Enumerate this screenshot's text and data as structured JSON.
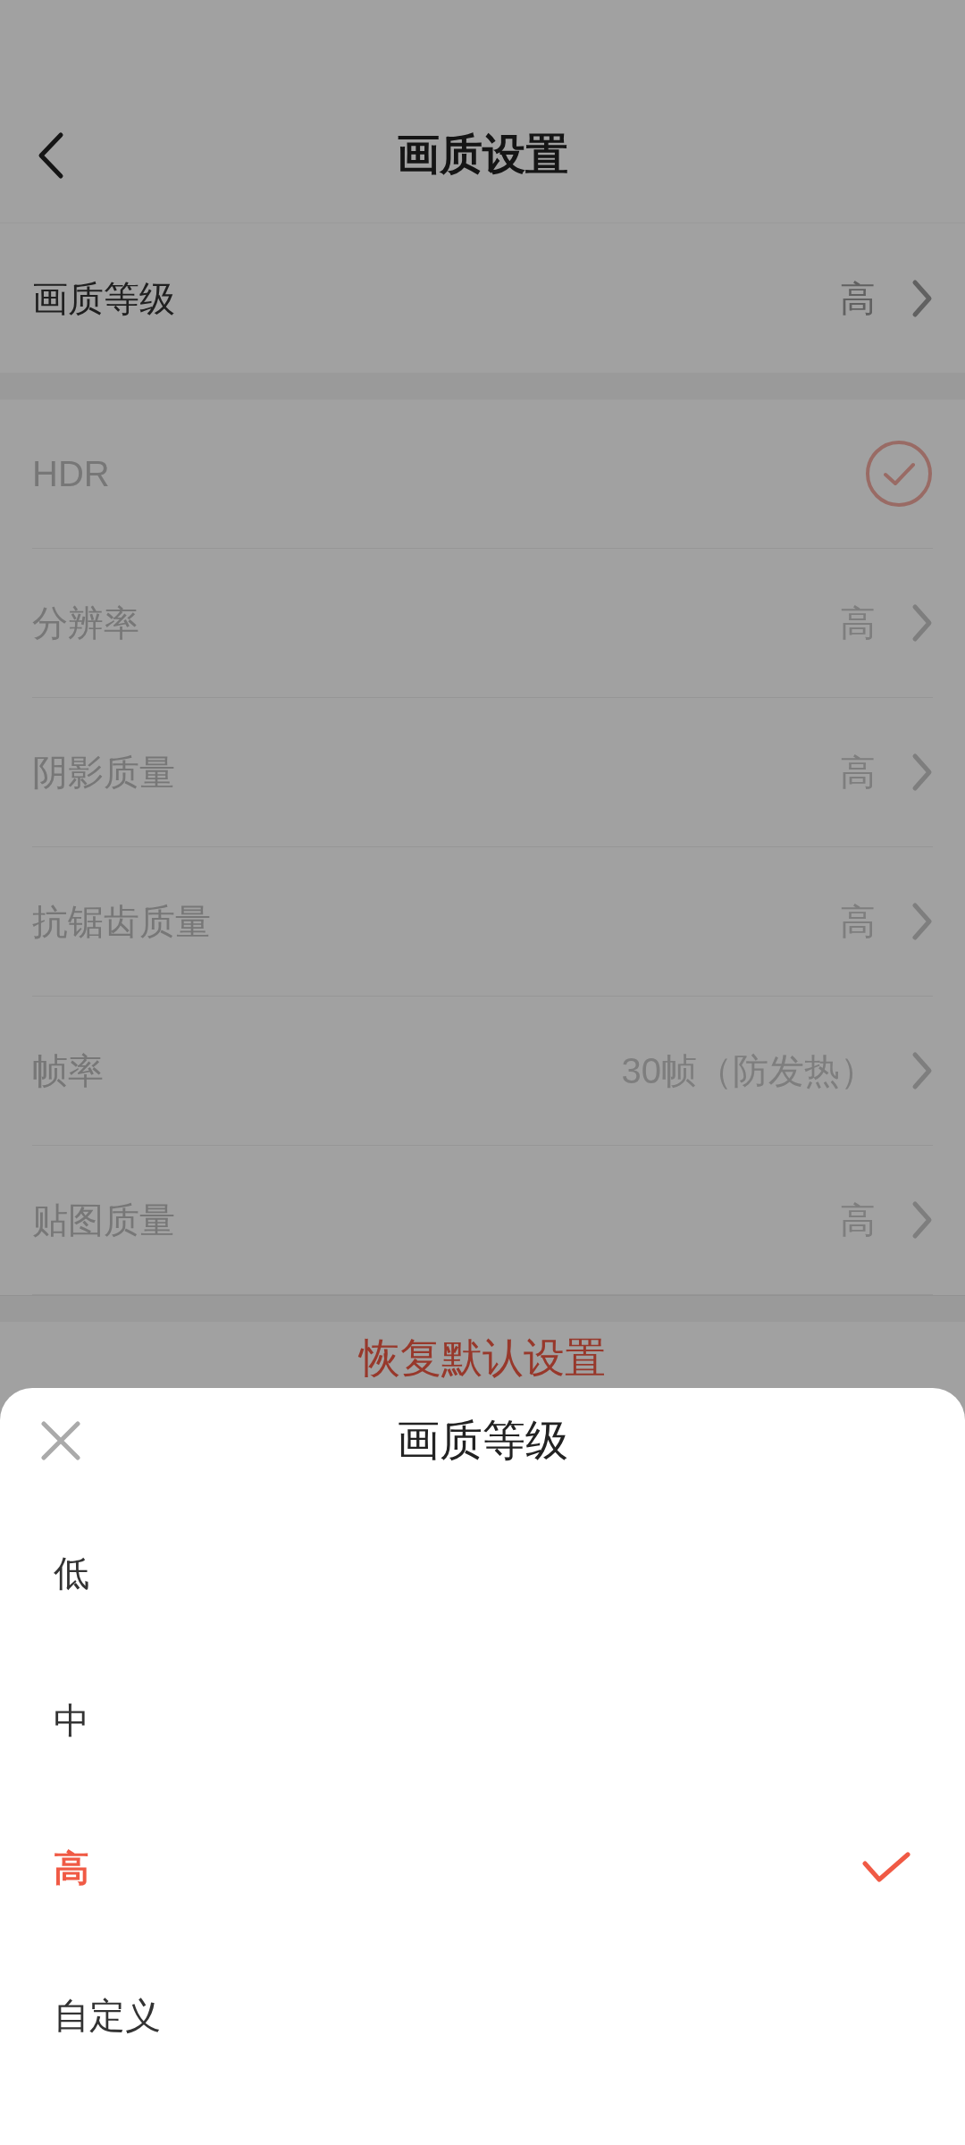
{
  "header": {
    "title": "画质设置"
  },
  "groups": [
    [
      {
        "kind": "select",
        "label": "画质等级",
        "value": "高",
        "disabled": false
      }
    ],
    [
      {
        "kind": "check",
        "label": "HDR",
        "checked": true,
        "disabled": true
      },
      {
        "kind": "select",
        "label": "分辨率",
        "value": "高",
        "disabled": true
      },
      {
        "kind": "select",
        "label": "阴影质量",
        "value": "高",
        "disabled": true
      },
      {
        "kind": "select",
        "label": "抗锯齿质量",
        "value": "高",
        "disabled": true
      },
      {
        "kind": "select",
        "label": "帧率",
        "value": "30帧（防发热）",
        "disabled": true
      },
      {
        "kind": "select",
        "label": "贴图质量",
        "value": "高",
        "disabled": true
      }
    ]
  ],
  "reset_button": "恢复默认设置",
  "sheet": {
    "title": "画质等级",
    "options": [
      {
        "label": "低",
        "selected": false
      },
      {
        "label": "中",
        "selected": false
      },
      {
        "label": "高",
        "selected": true
      },
      {
        "label": "自定义",
        "selected": false
      }
    ]
  }
}
